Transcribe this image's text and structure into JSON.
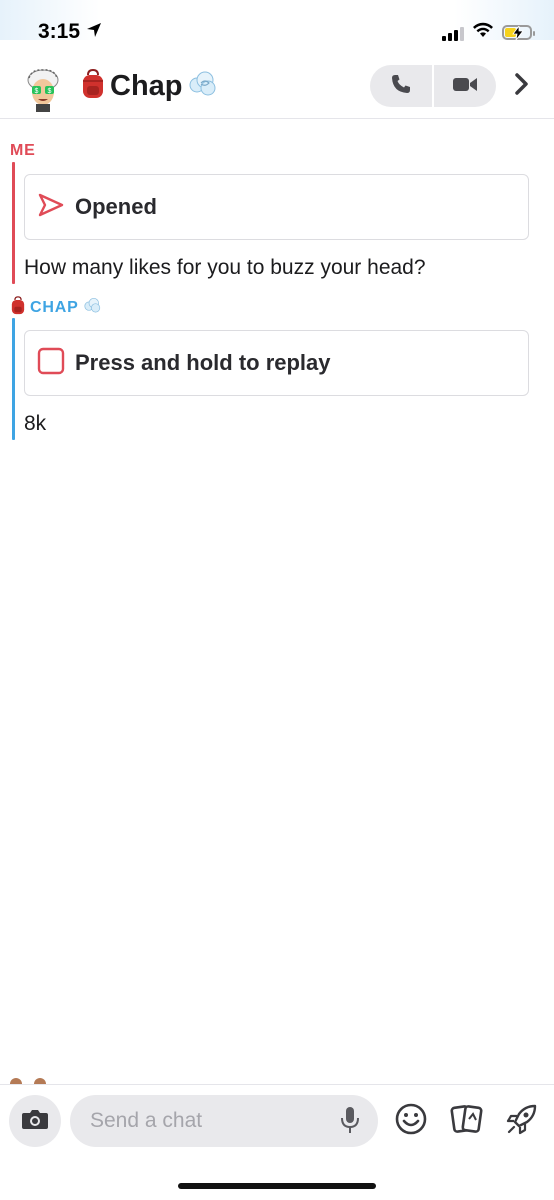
{
  "status_bar": {
    "time": "3:15",
    "location_icon": "location-arrow-icon",
    "battery_level": 0.45,
    "charging": true
  },
  "header": {
    "title": "Chap",
    "title_prefix_emoji": "backpack",
    "title_suffix_emoji": "dash",
    "avatar": "bitmoji-avatar",
    "icons": [
      "phone-icon",
      "video-camera-icon",
      "chevron-right-icon"
    ]
  },
  "messages": {
    "me": {
      "sender": "ME",
      "snap_status": "Opened",
      "text": "How many likes for you to buzz your head?"
    },
    "chap": {
      "sender": "CHAP",
      "snap_status": "Press and hold to replay",
      "text": "8k"
    }
  },
  "composer": {
    "placeholder": "Send a chat",
    "icons": [
      "camera-icon",
      "microphone-icon",
      "smiley-icon",
      "cards-icon",
      "rocket-icon"
    ]
  },
  "colors": {
    "me": "#e04b57",
    "chap": "#3ea4e3",
    "pill_bg": "#e9e9ec",
    "battery": "#f6d21d"
  }
}
